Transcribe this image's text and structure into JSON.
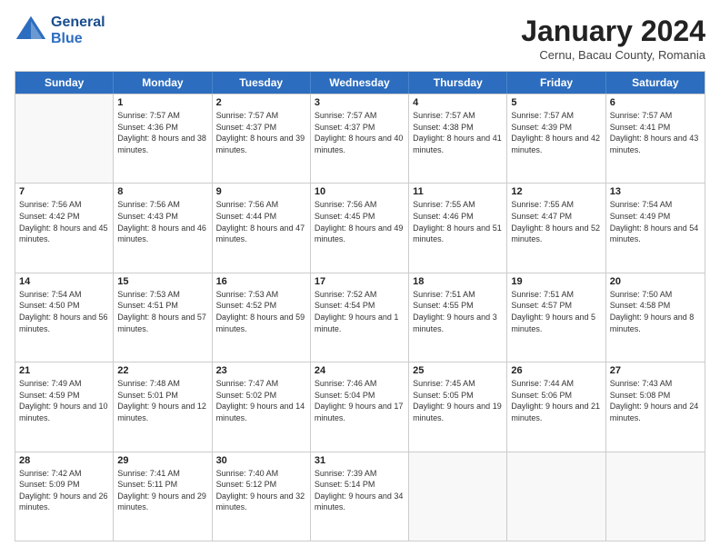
{
  "header": {
    "logo_line1": "General",
    "logo_line2": "Blue",
    "month_title": "January 2024",
    "subtitle": "Cernu, Bacau County, Romania"
  },
  "weekdays": [
    "Sunday",
    "Monday",
    "Tuesday",
    "Wednesday",
    "Thursday",
    "Friday",
    "Saturday"
  ],
  "rows": [
    [
      {
        "day": "",
        "sunrise": "",
        "sunset": "",
        "daylight": ""
      },
      {
        "day": "1",
        "sunrise": "Sunrise: 7:57 AM",
        "sunset": "Sunset: 4:36 PM",
        "daylight": "Daylight: 8 hours and 38 minutes."
      },
      {
        "day": "2",
        "sunrise": "Sunrise: 7:57 AM",
        "sunset": "Sunset: 4:37 PM",
        "daylight": "Daylight: 8 hours and 39 minutes."
      },
      {
        "day": "3",
        "sunrise": "Sunrise: 7:57 AM",
        "sunset": "Sunset: 4:37 PM",
        "daylight": "Daylight: 8 hours and 40 minutes."
      },
      {
        "day": "4",
        "sunrise": "Sunrise: 7:57 AM",
        "sunset": "Sunset: 4:38 PM",
        "daylight": "Daylight: 8 hours and 41 minutes."
      },
      {
        "day": "5",
        "sunrise": "Sunrise: 7:57 AM",
        "sunset": "Sunset: 4:39 PM",
        "daylight": "Daylight: 8 hours and 42 minutes."
      },
      {
        "day": "6",
        "sunrise": "Sunrise: 7:57 AM",
        "sunset": "Sunset: 4:41 PM",
        "daylight": "Daylight: 8 hours and 43 minutes."
      }
    ],
    [
      {
        "day": "7",
        "sunrise": "Sunrise: 7:56 AM",
        "sunset": "Sunset: 4:42 PM",
        "daylight": "Daylight: 8 hours and 45 minutes."
      },
      {
        "day": "8",
        "sunrise": "Sunrise: 7:56 AM",
        "sunset": "Sunset: 4:43 PM",
        "daylight": "Daylight: 8 hours and 46 minutes."
      },
      {
        "day": "9",
        "sunrise": "Sunrise: 7:56 AM",
        "sunset": "Sunset: 4:44 PM",
        "daylight": "Daylight: 8 hours and 47 minutes."
      },
      {
        "day": "10",
        "sunrise": "Sunrise: 7:56 AM",
        "sunset": "Sunset: 4:45 PM",
        "daylight": "Daylight: 8 hours and 49 minutes."
      },
      {
        "day": "11",
        "sunrise": "Sunrise: 7:55 AM",
        "sunset": "Sunset: 4:46 PM",
        "daylight": "Daylight: 8 hours and 51 minutes."
      },
      {
        "day": "12",
        "sunrise": "Sunrise: 7:55 AM",
        "sunset": "Sunset: 4:47 PM",
        "daylight": "Daylight: 8 hours and 52 minutes."
      },
      {
        "day": "13",
        "sunrise": "Sunrise: 7:54 AM",
        "sunset": "Sunset: 4:49 PM",
        "daylight": "Daylight: 8 hours and 54 minutes."
      }
    ],
    [
      {
        "day": "14",
        "sunrise": "Sunrise: 7:54 AM",
        "sunset": "Sunset: 4:50 PM",
        "daylight": "Daylight: 8 hours and 56 minutes."
      },
      {
        "day": "15",
        "sunrise": "Sunrise: 7:53 AM",
        "sunset": "Sunset: 4:51 PM",
        "daylight": "Daylight: 8 hours and 57 minutes."
      },
      {
        "day": "16",
        "sunrise": "Sunrise: 7:53 AM",
        "sunset": "Sunset: 4:52 PM",
        "daylight": "Daylight: 8 hours and 59 minutes."
      },
      {
        "day": "17",
        "sunrise": "Sunrise: 7:52 AM",
        "sunset": "Sunset: 4:54 PM",
        "daylight": "Daylight: 9 hours and 1 minute."
      },
      {
        "day": "18",
        "sunrise": "Sunrise: 7:51 AM",
        "sunset": "Sunset: 4:55 PM",
        "daylight": "Daylight: 9 hours and 3 minutes."
      },
      {
        "day": "19",
        "sunrise": "Sunrise: 7:51 AM",
        "sunset": "Sunset: 4:57 PM",
        "daylight": "Daylight: 9 hours and 5 minutes."
      },
      {
        "day": "20",
        "sunrise": "Sunrise: 7:50 AM",
        "sunset": "Sunset: 4:58 PM",
        "daylight": "Daylight: 9 hours and 8 minutes."
      }
    ],
    [
      {
        "day": "21",
        "sunrise": "Sunrise: 7:49 AM",
        "sunset": "Sunset: 4:59 PM",
        "daylight": "Daylight: 9 hours and 10 minutes."
      },
      {
        "day": "22",
        "sunrise": "Sunrise: 7:48 AM",
        "sunset": "Sunset: 5:01 PM",
        "daylight": "Daylight: 9 hours and 12 minutes."
      },
      {
        "day": "23",
        "sunrise": "Sunrise: 7:47 AM",
        "sunset": "Sunset: 5:02 PM",
        "daylight": "Daylight: 9 hours and 14 minutes."
      },
      {
        "day": "24",
        "sunrise": "Sunrise: 7:46 AM",
        "sunset": "Sunset: 5:04 PM",
        "daylight": "Daylight: 9 hours and 17 minutes."
      },
      {
        "day": "25",
        "sunrise": "Sunrise: 7:45 AM",
        "sunset": "Sunset: 5:05 PM",
        "daylight": "Daylight: 9 hours and 19 minutes."
      },
      {
        "day": "26",
        "sunrise": "Sunrise: 7:44 AM",
        "sunset": "Sunset: 5:06 PM",
        "daylight": "Daylight: 9 hours and 21 minutes."
      },
      {
        "day": "27",
        "sunrise": "Sunrise: 7:43 AM",
        "sunset": "Sunset: 5:08 PM",
        "daylight": "Daylight: 9 hours and 24 minutes."
      }
    ],
    [
      {
        "day": "28",
        "sunrise": "Sunrise: 7:42 AM",
        "sunset": "Sunset: 5:09 PM",
        "daylight": "Daylight: 9 hours and 26 minutes."
      },
      {
        "day": "29",
        "sunrise": "Sunrise: 7:41 AM",
        "sunset": "Sunset: 5:11 PM",
        "daylight": "Daylight: 9 hours and 29 minutes."
      },
      {
        "day": "30",
        "sunrise": "Sunrise: 7:40 AM",
        "sunset": "Sunset: 5:12 PM",
        "daylight": "Daylight: 9 hours and 32 minutes."
      },
      {
        "day": "31",
        "sunrise": "Sunrise: 7:39 AM",
        "sunset": "Sunset: 5:14 PM",
        "daylight": "Daylight: 9 hours and 34 minutes."
      },
      {
        "day": "",
        "sunrise": "",
        "sunset": "",
        "daylight": ""
      },
      {
        "day": "",
        "sunrise": "",
        "sunset": "",
        "daylight": ""
      },
      {
        "day": "",
        "sunrise": "",
        "sunset": "",
        "daylight": ""
      }
    ]
  ]
}
